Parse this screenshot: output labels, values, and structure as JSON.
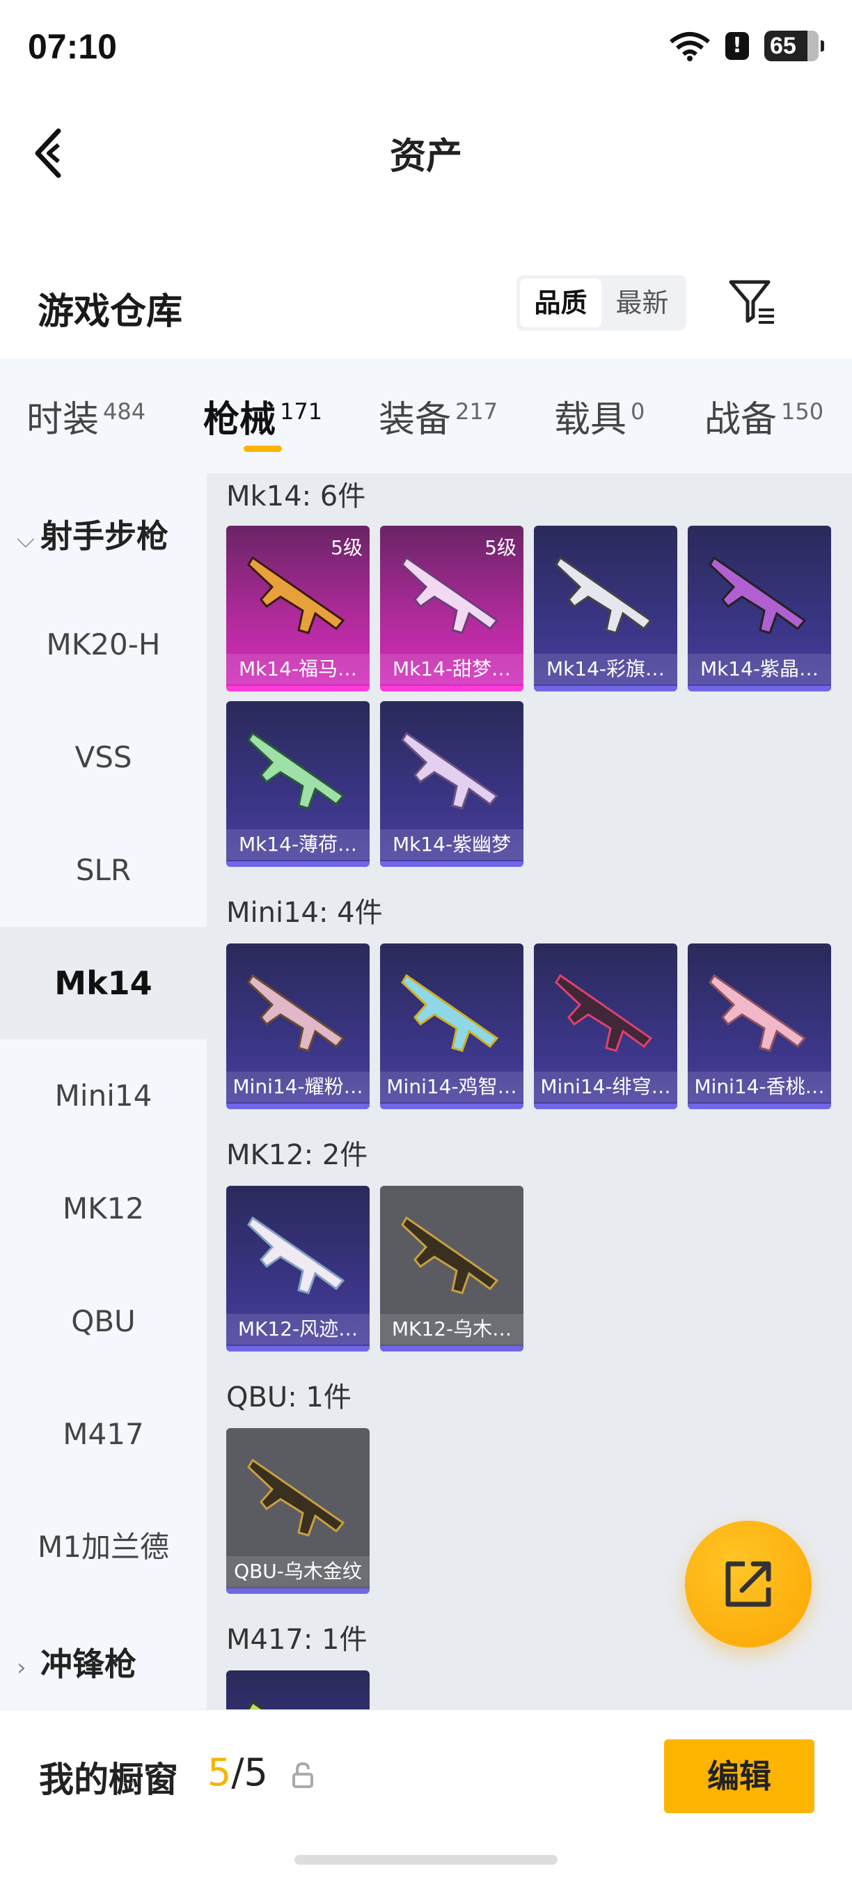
{
  "status": {
    "time": "07:10",
    "battery": "65",
    "alert": "!"
  },
  "header": {
    "title": "资产"
  },
  "warehouse": {
    "title": "游戏仓库",
    "sort_options": [
      "品质",
      "最新"
    ]
  },
  "tabs": [
    {
      "label": "时装",
      "count": "484"
    },
    {
      "label": "枪械",
      "count": "171"
    },
    {
      "label": "装备",
      "count": "217"
    },
    {
      "label": "载具",
      "count": "0"
    },
    {
      "label": "战备",
      "count": "150"
    }
  ],
  "sidebar": {
    "cat1": "射手步枪",
    "items": [
      "MK20-H",
      "VSS",
      "SLR",
      "Mk14",
      "Mini14",
      "MK12",
      "QBU",
      "M417",
      "M1加兰德"
    ],
    "cat2": "冲锋枪"
  },
  "groups": [
    {
      "title": "Mk14: 6件",
      "cards": [
        {
          "name": "Mk14-福马…",
          "level": "5级"
        },
        {
          "name": "Mk14-甜梦…",
          "level": "5级"
        },
        {
          "name": "Mk14-彩旗…"
        },
        {
          "name": "Mk14-紫晶…"
        },
        {
          "name": "Mk14-薄荷…"
        },
        {
          "name": "Mk14-紫幽梦"
        }
      ]
    },
    {
      "title": "Mini14: 4件",
      "cards": [
        {
          "name": "Mini14-耀粉…"
        },
        {
          "name": "Mini14-鸡智…"
        },
        {
          "name": "Mini14-绯穹…"
        },
        {
          "name": "Mini14-香桃…"
        }
      ]
    },
    {
      "title": "MK12: 2件",
      "cards": [
        {
          "name": "MK12-风迹…"
        },
        {
          "name": "MK12-乌木…"
        }
      ]
    },
    {
      "title": "QBU: 1件",
      "cards": [
        {
          "name": "QBU-乌木金纹"
        }
      ]
    },
    {
      "title": "M417: 1件"
    }
  ],
  "bottom": {
    "label": "我的橱窗",
    "current": "5",
    "total": "/5",
    "edit_label": "编辑"
  }
}
